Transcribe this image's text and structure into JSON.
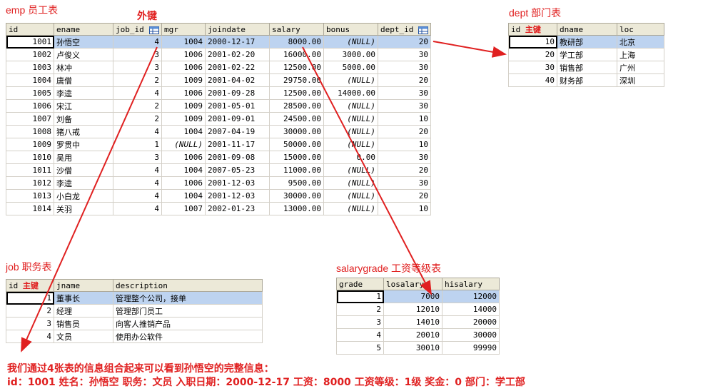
{
  "emp": {
    "title": "emp 员工表",
    "fk_label": "外键",
    "columns": [
      "id",
      "ename",
      "job_id",
      "mgr",
      "joindate",
      "salary",
      "bonus",
      "dept_id"
    ],
    "rows": [
      [
        "1001",
        "孙悟空",
        "4",
        "1004",
        "2000-12-17",
        "8000.00",
        "(NULL)",
        "20"
      ],
      [
        "1002",
        "卢俊义",
        "3",
        "1006",
        "2001-02-20",
        "16000.00",
        "3000.00",
        "30"
      ],
      [
        "1003",
        "林冲",
        "3",
        "1006",
        "2001-02-22",
        "12500.00",
        "5000.00",
        "30"
      ],
      [
        "1004",
        "唐僧",
        "2",
        "1009",
        "2001-04-02",
        "29750.00",
        "(NULL)",
        "20"
      ],
      [
        "1005",
        "李逵",
        "4",
        "1006",
        "2001-09-28",
        "12500.00",
        "14000.00",
        "30"
      ],
      [
        "1006",
        "宋江",
        "2",
        "1009",
        "2001-05-01",
        "28500.00",
        "(NULL)",
        "30"
      ],
      [
        "1007",
        "刘备",
        "2",
        "1009",
        "2001-09-01",
        "24500.00",
        "(NULL)",
        "10"
      ],
      [
        "1008",
        "猪八戒",
        "4",
        "1004",
        "2007-04-19",
        "30000.00",
        "(NULL)",
        "20"
      ],
      [
        "1009",
        "罗贯中",
        "1",
        "(NULL)",
        "2001-11-17",
        "50000.00",
        "(NULL)",
        "10"
      ],
      [
        "1010",
        "吴用",
        "3",
        "1006",
        "2001-09-08",
        "15000.00",
        "0.00",
        "30"
      ],
      [
        "1011",
        "沙僧",
        "4",
        "1004",
        "2007-05-23",
        "11000.00",
        "(NULL)",
        "20"
      ],
      [
        "1012",
        "李逵",
        "4",
        "1006",
        "2001-12-03",
        "9500.00",
        "(NULL)",
        "30"
      ],
      [
        "1013",
        "小白龙",
        "4",
        "1004",
        "2001-12-03",
        "30000.00",
        "(NULL)",
        "20"
      ],
      [
        "1014",
        "关羽",
        "4",
        "1007",
        "2002-01-23",
        "13000.00",
        "(NULL)",
        "10"
      ]
    ]
  },
  "dept": {
    "title": "dept 部门表",
    "columns": [
      "id",
      "dname",
      "loc"
    ],
    "pk_label": "主键",
    "rows": [
      [
        "10",
        "教研部",
        "北京"
      ],
      [
        "20",
        "学工部",
        "上海"
      ],
      [
        "30",
        "销售部",
        "广州"
      ],
      [
        "40",
        "财务部",
        "深圳"
      ]
    ]
  },
  "job": {
    "title": "job 职务表",
    "columns": [
      "id",
      "jname",
      "description"
    ],
    "pk_label": "主键",
    "rows": [
      [
        "1",
        "董事长",
        "管理整个公司，接单"
      ],
      [
        "2",
        "经理",
        "管理部门员工"
      ],
      [
        "3",
        "销售员",
        "向客人推销产品"
      ],
      [
        "4",
        "文员",
        "使用办公软件"
      ]
    ]
  },
  "salarygrade": {
    "title": "salarygrade 工资等级表",
    "columns": [
      "grade",
      "losalary",
      "hisalary"
    ],
    "rows": [
      [
        "1",
        "7000",
        "12000"
      ],
      [
        "2",
        "12010",
        "14000"
      ],
      [
        "3",
        "14010",
        "20000"
      ],
      [
        "4",
        "20010",
        "30000"
      ],
      [
        "5",
        "30010",
        "99990"
      ]
    ]
  },
  "summary": {
    "line1": "我们通过4张表的信息组合起来可以看到孙悟空的完整信息：",
    "line2": "id：1001        姓名：孙悟空   职务：文员      入职日期：2000-12-17       工资：8000    工资等级：1级           奖金：0            部门：学工部"
  },
  "colors": {
    "annotation": "#e02020",
    "selected_row": "#bdd3f0",
    "header_bg": "#ece9d8"
  }
}
